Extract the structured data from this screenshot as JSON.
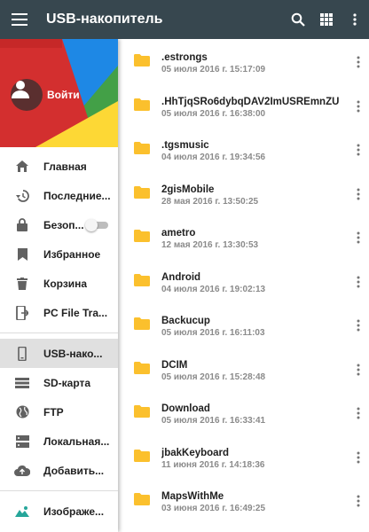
{
  "appbar": {
    "title": "USB-накопитель",
    "menu_icon": "menu-icon",
    "actions": [
      "search-icon",
      "grid-view-icon",
      "more-vert-icon"
    ]
  },
  "drawer": {
    "login_label": "Войти",
    "items": [
      {
        "label": "Главная",
        "icon": "home-icon"
      },
      {
        "label": "Последние...",
        "icon": "history-icon"
      },
      {
        "label": "Безоп...",
        "icon": "lock-icon",
        "toggle": false
      },
      {
        "label": "Избранное",
        "icon": "bookmark-icon"
      },
      {
        "label": "Корзина",
        "icon": "trash-icon"
      },
      {
        "label": "PC File Tra...",
        "icon": "pc-transfer-icon"
      },
      {
        "label": "USB-нако...",
        "icon": "usb-storage-icon",
        "active": true
      },
      {
        "label": "SD-карта",
        "icon": "sd-card-icon"
      },
      {
        "label": "FTP",
        "icon": "globe-icon"
      },
      {
        "label": "Локальная...",
        "icon": "server-icon"
      },
      {
        "label": "Добавить...",
        "icon": "cloud-upload-icon"
      },
      {
        "label": "Изображе...",
        "icon": "image-icon"
      }
    ]
  },
  "files": [
    {
      "name": ".estrongs",
      "date": "05 июля 2016 г. 15:17:09"
    },
    {
      "name": ".HhTjqSRo6dybqDAV2ImUSREmnZU=",
      "date": "05 июля 2016 г. 16:38:00"
    },
    {
      "name": ".tgsmusic",
      "date": "04 июля 2016 г. 19:34:56"
    },
    {
      "name": "2gisMobile",
      "date": "28 мая 2016 г. 13:50:25"
    },
    {
      "name": "ametro",
      "date": "12 мая 2016 г. 13:30:53"
    },
    {
      "name": "Android",
      "date": "04 июля 2016 г. 19:02:13"
    },
    {
      "name": "Backucup",
      "date": "05 июля 2016 г. 16:11:03"
    },
    {
      "name": "DCIM",
      "date": "05 июля 2016 г. 15:28:48"
    },
    {
      "name": "Download",
      "date": "05 июля 2016 г. 16:33:41"
    },
    {
      "name": "jbakKeyboard",
      "date": "11 июня 2016 г. 14:18:36"
    },
    {
      "name": "MapsWithMe",
      "date": "03 июня 2016 г. 16:49:25"
    }
  ],
  "colors": {
    "appbar": "#37474f",
    "folder": "#fbc02d",
    "header_red": "#d32f2f",
    "header_blue": "#1e88e5",
    "header_yellow": "#fdd835",
    "header_green": "#43a047"
  }
}
